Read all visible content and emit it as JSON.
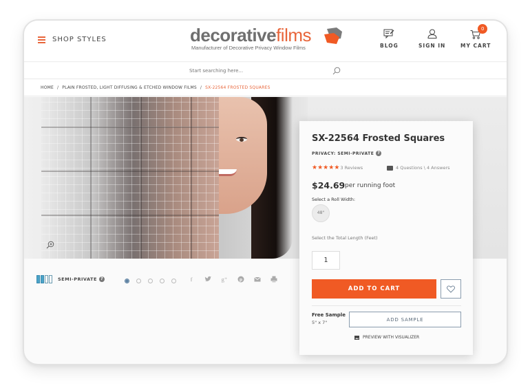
{
  "header": {
    "menu_label": "SHOP STYLES",
    "logo": {
      "brand_part1": "decorative",
      "brand_part2": "films",
      "tagline": "Manufacturer of Decorative Privacy Window Films"
    },
    "nav": [
      {
        "label": "BLOG",
        "icon": "blog-icon"
      },
      {
        "label": "SIGN IN",
        "icon": "user-icon"
      },
      {
        "label": "MY CART",
        "icon": "cart-icon",
        "badge": "0"
      }
    ]
  },
  "search": {
    "placeholder": "Start searching here...",
    "value": ""
  },
  "breadcrumb": {
    "items": [
      "HOME",
      "PLAIN FROSTED, LIGHT DIFFUSING & ETCHED WINDOW FILMS",
      "SX-22564 FROSTED SQUARES"
    ],
    "separator": "/"
  },
  "gallery": {
    "privacy_label": "SEMI-PRIVATE",
    "privacy_level": 2,
    "privacy_max": 4,
    "slide_count": 5,
    "active_slide": 1,
    "share": [
      "f",
      "twitter",
      "g+",
      "pinterest",
      "email",
      "print"
    ]
  },
  "product": {
    "title": "SX-22564 Frosted Squares",
    "privacy": "PRIVACY: SEMI-PRIVATE",
    "rating": 5,
    "reviews": "3 Reviews",
    "qa": "4 Questions \\ 4 Answers",
    "price": "$24.69",
    "price_unit": "per running foot",
    "roll_width_label": "Select a Roll Width:",
    "roll_width_option": "48\"",
    "length_label": "Select the Total Length (Feet)",
    "quantity": "1",
    "add_to_cart": "ADD TO CART",
    "sample_title": "Free Sample",
    "sample_size": "5\" x 7\"",
    "add_sample": "ADD SAMPLE",
    "visualizer": "PREVIEW WITH VISUALIZER"
  },
  "colors": {
    "accent": "#f05a24",
    "privacy_bar": "#4aa3c8"
  }
}
